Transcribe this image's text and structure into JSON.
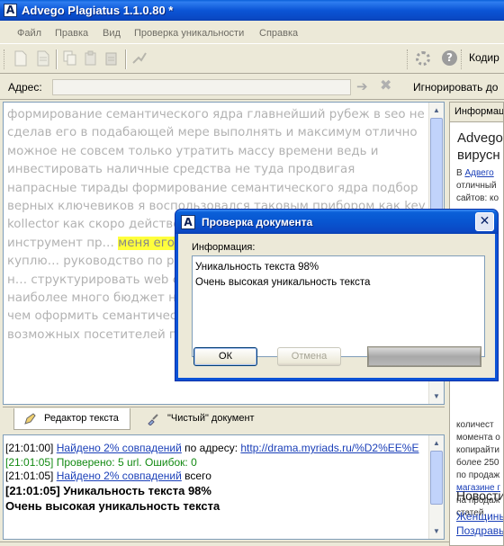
{
  "window": {
    "title": "Advego Plagiatus 1.1.0.80 *",
    "logo_letter": "A"
  },
  "menu": [
    "Файл",
    "Правка",
    "Вид",
    "Проверка уникальности",
    "Справка"
  ],
  "toolbar": {
    "encoding_label": "Кодир",
    "help_glyph": "?"
  },
  "address": {
    "label": "Адрес:",
    "value": "",
    "ignore_label": "Игнорировать до"
  },
  "editor": {
    "text_before": "формирование семантического ядра главнейший рубеж в seo не сделав его в подабающей мере выполнять и максимум отлично можное не совсем только утратить массу времени ведь и инвестировать наличные средства не туда продвигая напрасные тирады формирование семантического ядра подбор верных ключевиков я воспользовался таковым прибором как key kollector как скоро действовал в рынке … посетителей инструмент пр… ",
    "highlight": "меня его нет",
    "text_after": " и обрисовые… вероятно как скоро куплю… руководство по работе с н… семантическое ядро нам н… структурировать web сайт… странички нас появятся ис… наиболее много бюджет на… переходованные тирады прежде чем оформить семантическое ядро определите размах ваших возможных посетителей гостей и"
  },
  "tabs": [
    {
      "label": "Редактор текста",
      "active": true
    },
    {
      "label": "\"Чистый\" документ",
      "active": false
    }
  ],
  "log": [
    {
      "time": "[21:01:00]",
      "link": "Найдено 2% совпадений",
      "mid": " по адресу: ",
      "url": "http://drama.myriads.ru/%D2%EE%E"
    },
    {
      "time": "[21:01:05]",
      "text": "Проверено: 5 url. Ошибок: 0"
    },
    {
      "time": "[21:01:05]",
      "link": "Найдено 2% совпадений",
      "mid": " всего"
    },
    {
      "time": "[21:01:05]",
      "text": "Уникальность текста 98%"
    },
    {
      "text": "Очень высокая уникальность текста"
    }
  ],
  "side_panel": {
    "tab_label": "Информац",
    "heading_1": "Advego",
    "heading_2": "вирусн",
    "body_lines": [
      "В Адвего",
      "отличный",
      "сайтов: ко",
      "",
      "",
      "",
      "",
      "",
      "",
      "",
      "",
      "",
      "",
      "",
      "",
      "",
      "",
      "",
      "",
      "",
      "",
      "",
      "количест",
      "момента о",
      "копирайти",
      "более 250",
      "по продаж",
      "магазине г",
      "на продаж",
      "статей."
    ],
    "news_heading": "Новости",
    "news_links": [
      "Женщины",
      "Поздравь"
    ]
  },
  "dialog": {
    "title": "Проверка документа",
    "info_label": "Информация:",
    "lines": [
      "Уникальность текста 98%",
      "Очень высокая уникальность текста"
    ],
    "ok_label": "ОК",
    "cancel_label": "Отмена",
    "close_glyph": "✕",
    "progress": 1.0
  }
}
